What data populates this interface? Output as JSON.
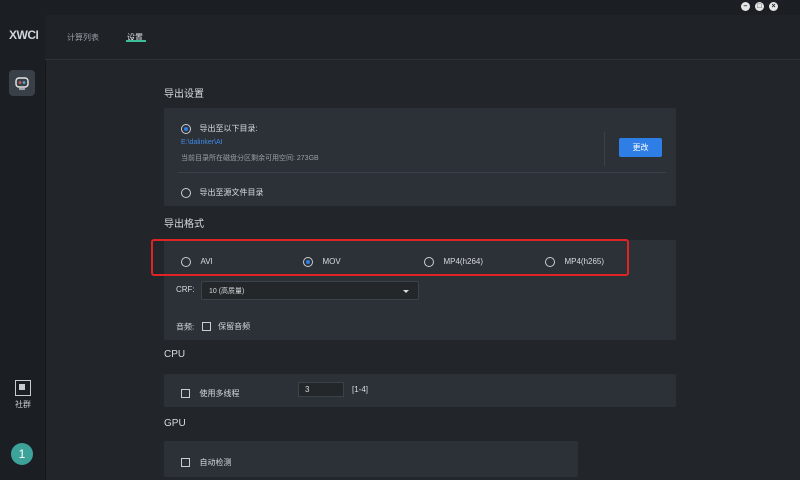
{
  "app": {
    "logo_text": "XWCI"
  },
  "window_controls": [
    "minimize",
    "maximize",
    "close"
  ],
  "sidebar": {
    "community_label": "社群",
    "avatar_label": "1"
  },
  "tabs": [
    {
      "label": "计算列表",
      "active": false
    },
    {
      "label": "设置",
      "active": true
    }
  ],
  "export_settings": {
    "title": "导出设置",
    "option_dir_label": "导出至以下目录:",
    "dir_path": "E:\\dalinker\\AI",
    "disk_info": "当前目录所在磁盘分区剩余可用空间: 273GB",
    "change_button": "更改",
    "option_source_label": "导出至源文件目录",
    "selected": "dir"
  },
  "export_format": {
    "title": "导出格式",
    "formats": [
      {
        "label": "AVI",
        "selected": false
      },
      {
        "label": "MOV",
        "selected": true
      },
      {
        "label": "MP4(h264)",
        "selected": false
      },
      {
        "label": "MP4(h265)",
        "selected": false
      }
    ],
    "crf_label": "CRF:",
    "crf_value": "10 (高质量)",
    "audio_label": "音频:",
    "keep_audio_label": "保留音频"
  },
  "cpu": {
    "title": "CPU",
    "multithread_label": "使用多线程",
    "thread_value": "3",
    "range": "[1-4]"
  },
  "gpu": {
    "title": "GPU",
    "auto_detect_label": "自动检测"
  },
  "colors": {
    "accent": "#2f7ee6",
    "tab_underline": "#3bbf9a",
    "highlight": "#e02424"
  }
}
